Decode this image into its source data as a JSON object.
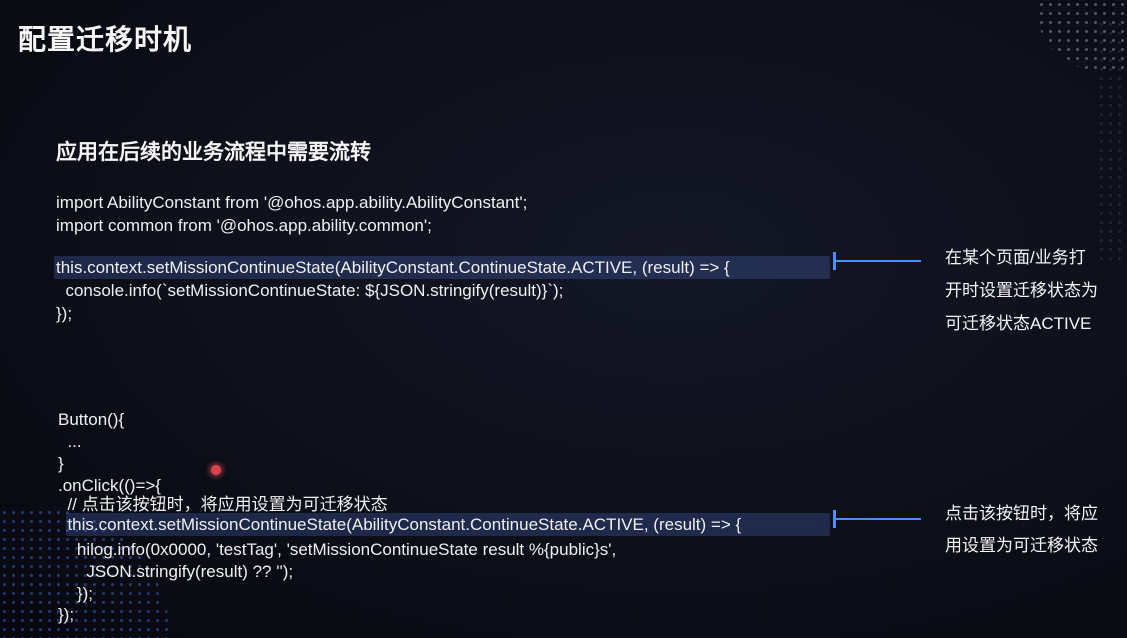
{
  "slide": {
    "title": "配置迁移时机",
    "subtitle": "应用在后续的业务流程中需要流转"
  },
  "code_block_1": {
    "lines": [
      "import AbilityConstant from '@ohos.app.ability.AbilityConstant';",
      "import common from '@ohos.app.ability.common';",
      "this.context.setMissionContinueState(AbilityConstant.ContinueState.ACTIVE, (result) => {",
      "  console.info(`setMissionContinueState: ${JSON.stringify(result)}`);",
      "});"
    ]
  },
  "code_block_2": {
    "lines": [
      "Button(){",
      "  ...",
      "}",
      ".onClick(()=>{",
      "  // 点击该按钮时，将应用设置为可迁移状态",
      "  this.context.setMissionContinueState(AbilityConstant.ContinueState.ACTIVE, (result) => {",
      "    hilog.info(0x0000, 'testTag', 'setMissionContinueState result %{public}s',",
      "      JSON.stringify(result) ?? '');",
      "    });",
      "});"
    ]
  },
  "annotations": [
    {
      "lines": [
        "在某个页面/业务打",
        "开时设置迁移状态为",
        "可迁移状态ACTIVE"
      ]
    },
    {
      "lines": [
        "点击该按钮时，将应",
        "用设置为可迁移状态"
      ]
    }
  ],
  "colors": {
    "background": "#0c0e17",
    "text": "#f2f2f2",
    "accent": "#4f8dff",
    "highlight": "#4e6ecd",
    "laser_pointer": "#d9414e"
  }
}
